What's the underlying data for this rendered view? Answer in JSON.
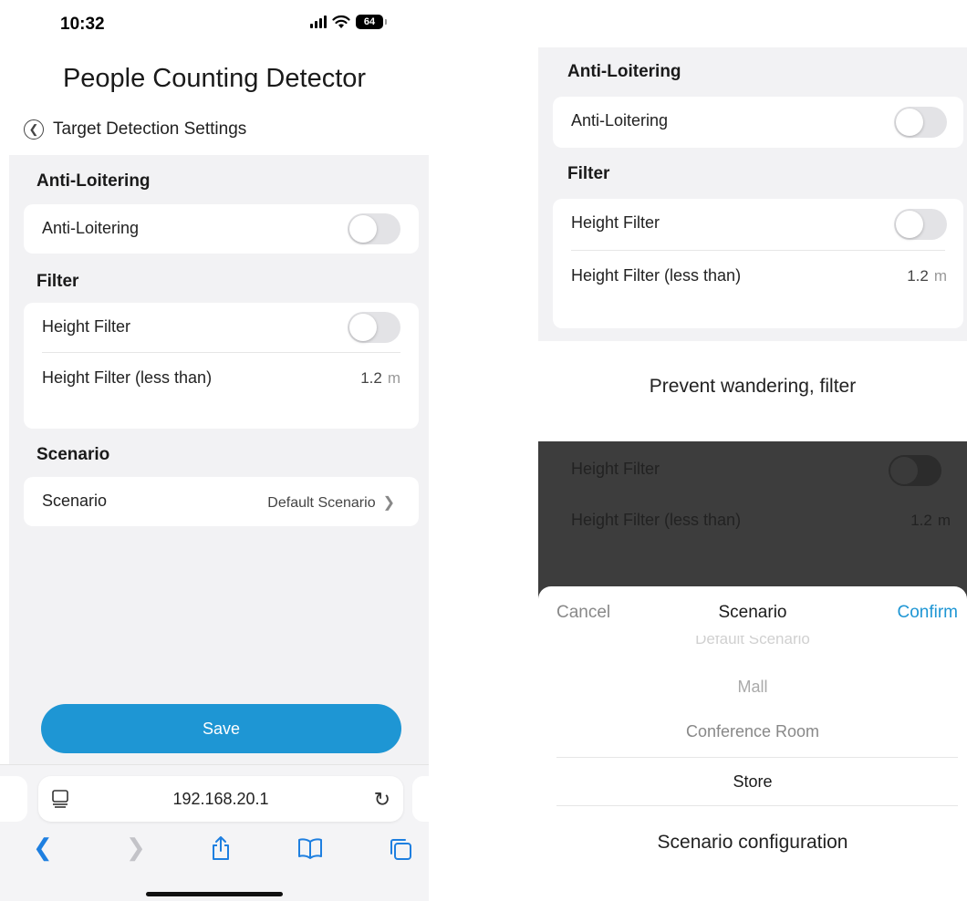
{
  "left_phone": {
    "status": {
      "time": "10:32",
      "battery": "64"
    },
    "title": "People Counting Detector",
    "back_label": "Target Detection Settings",
    "anti_loitering": {
      "section": "Anti-Loitering",
      "toggle_label": "Anti-Loitering"
    },
    "filter": {
      "section": "Filter",
      "height_filter_label": "Height Filter",
      "height_less_label": "Height Filter (less than)",
      "height_value": "1.2",
      "height_unit": "m"
    },
    "scenario": {
      "section": "Scenario",
      "label": "Scenario",
      "value": "Default Scenario"
    },
    "save_label": "Save",
    "url": "192.168.20.1"
  },
  "right_top": {
    "anti_loitering": {
      "section": "Anti-Loitering",
      "toggle_label": "Anti-Loitering"
    },
    "filter": {
      "section": "Filter",
      "height_filter_label": "Height Filter",
      "height_less_label": "Height Filter (less than)",
      "height_value": "1.2",
      "height_unit": "m"
    },
    "caption": "Prevent wandering, filter"
  },
  "right_bottom": {
    "background": {
      "height_filter_label": "Height Filter",
      "height_less_label": "Height Filter (less than)",
      "height_value": "1.2",
      "height_unit": "m"
    },
    "sheet": {
      "cancel": "Cancel",
      "title": "Scenario",
      "confirm": "Confirm",
      "options": [
        "Default Scenario",
        "Mall",
        "Conference Room",
        "Store"
      ],
      "selected": "Store"
    },
    "caption": "Scenario configuration"
  },
  "colors": {
    "accent": "#1e96d4",
    "link": "#1e7fe0",
    "background": "#f2f2f4"
  }
}
